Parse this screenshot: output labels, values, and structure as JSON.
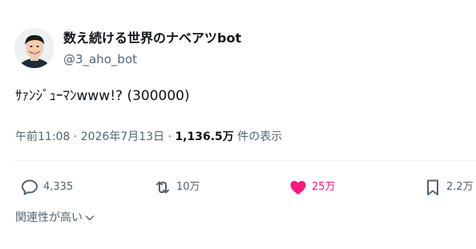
{
  "account": {
    "name": "数え続ける世界のナベアツbot",
    "handle": "@3_aho_bot",
    "avatar_icon": "person-avatar-icon"
  },
  "tweet": {
    "text": "ｻｧﾝｼﾞｭｰﾏﾝwww!?  (300000)"
  },
  "meta": {
    "time": "午前11:08",
    "separator": " · ",
    "date": "2026年7月13日",
    "views_count": "1,136.5万",
    "views_label": " 件の表示"
  },
  "actions": {
    "reply": {
      "icon": "reply-bubble-icon",
      "count": "4,335"
    },
    "retweet": {
      "icon": "retweet-icon",
      "count": "10万"
    },
    "like": {
      "icon": "heart-icon",
      "count": "25万",
      "color": "#f91880"
    },
    "bookmark": {
      "icon": "bookmark-icon",
      "count": "2.2万"
    }
  },
  "related": {
    "label": "関連性が高い",
    "icon": "chevron-down-icon"
  },
  "colors": {
    "text": "#0f1419",
    "secondary": "#536471",
    "like": "#f91880"
  }
}
